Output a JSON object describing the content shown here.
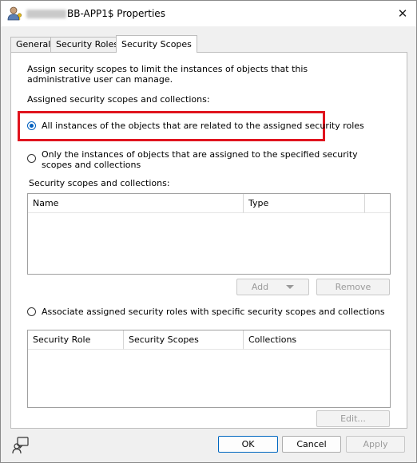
{
  "window": {
    "title_suffix": "BB-APP1$ Properties",
    "close_symbol": "✕"
  },
  "tabs": [
    {
      "label": "General"
    },
    {
      "label": "Security Roles"
    },
    {
      "label": "Security Scopes"
    }
  ],
  "scopes": {
    "description": "Assign security scopes to limit the instances of objects that  this administrative user can manage.",
    "section_label": "Assigned security scopes and collections:",
    "option_all": "All instances of the objects that are related to the assigned security roles",
    "option_specified": "Only the instances of objects  that are assigned to the specified security scopes and collections",
    "list_label": "Security scopes and collections:",
    "scopes_columns": [
      "Name",
      "Type"
    ],
    "add_label": "Add",
    "remove_label": "Remove",
    "option_associate": "Associate assigned security roles with specific security scopes and collections",
    "roles_columns": [
      "Security Role",
      "Security Scopes",
      "Collections"
    ],
    "edit_label": "Edit..."
  },
  "buttons": {
    "ok": "OK",
    "cancel": "Cancel",
    "apply": "Apply"
  },
  "selected_option": "option_all",
  "colors": {
    "accent": "#0060c0",
    "highlight": "#e0141e"
  }
}
